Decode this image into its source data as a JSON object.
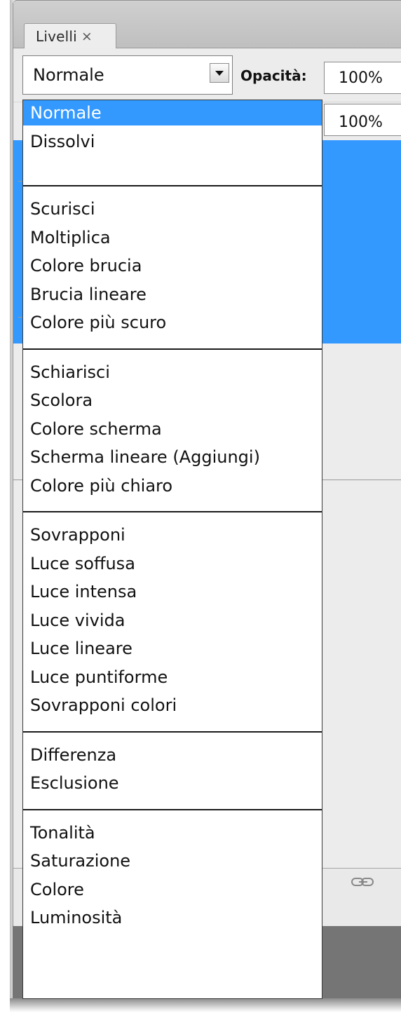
{
  "panel": {
    "tab_label": "Livelli",
    "tab_close": "×"
  },
  "toolbar": {
    "blend_mode_value": "Normale",
    "opacity_label": "Opacità:",
    "opacity_value": "100%",
    "fill_value": "100%"
  },
  "colors": {
    "selection": "#3399ff",
    "panel_bg": "#ececec"
  },
  "blend_menu": {
    "groups": [
      [
        "Normale",
        "Dissolvi"
      ],
      [
        "Scurisci",
        "Moltiplica",
        "Colore brucia",
        "Brucia lineare",
        "Colore più scuro"
      ],
      [
        "Schiarisci",
        "Scolora",
        "Colore scherma",
        "Scherma lineare (Aggiungi)",
        "Colore più chiaro"
      ],
      [
        "Sovrapponi",
        "Luce soffusa",
        "Luce intensa",
        "Luce vivida",
        "Luce lineare",
        "Luce puntiforme",
        "Sovrapponi colori"
      ],
      [
        "Differenza",
        "Esclusione"
      ],
      [
        "Tonalità",
        "Saturazione",
        "Colore",
        "Luminosità"
      ]
    ],
    "selected": "Normale"
  },
  "footer": {
    "link_icon": "link-icon"
  }
}
